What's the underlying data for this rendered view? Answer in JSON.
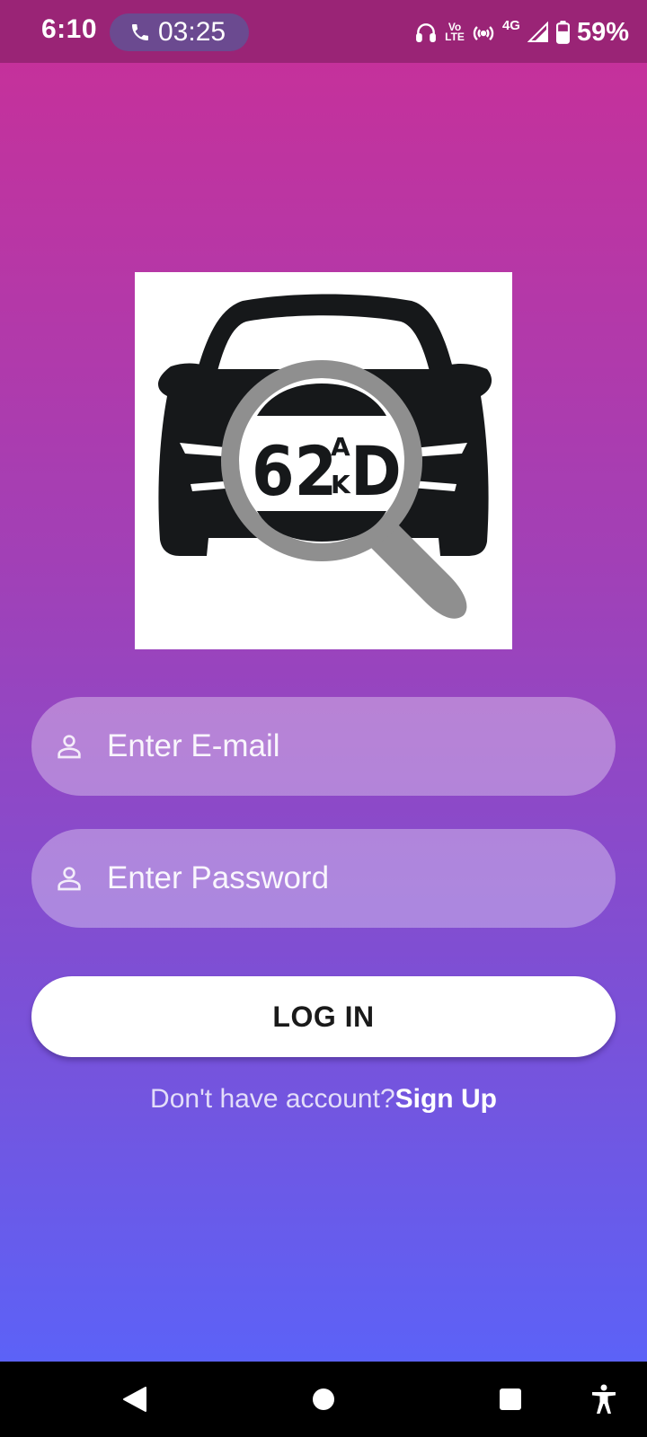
{
  "status_bar": {
    "time": "6:10",
    "call_duration": "03:25",
    "network_label": "4G",
    "volte_label_top": "Vo",
    "volte_label_bottom": "LTE",
    "battery_percent": "59%",
    "icons": [
      "headphones-icon",
      "volte-icon",
      "hotspot-icon",
      "signal-icon",
      "battery-icon"
    ]
  },
  "logo": {
    "plate_digits": "62",
    "plate_letter_top": "A",
    "plate_letter_bottom": "K",
    "plate_letter_right": "D"
  },
  "form": {
    "email_placeholder": "Enter E-mail",
    "password_placeholder": "Enter Password",
    "login_label": "LOG IN",
    "signup_prompt": "Don't have account?",
    "signup_link": "Sign Up"
  },
  "colors": {
    "gradient_top": "#c5319b",
    "gradient_bottom": "#5c62f7",
    "status_bar": "#9a2476"
  }
}
